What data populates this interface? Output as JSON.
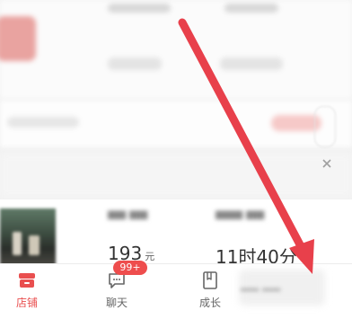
{
  "stats": {
    "value_1": "193",
    "unit_1": "元",
    "value_2": "11时40分"
  },
  "tabbar": {
    "tabs": [
      {
        "label": "店铺",
        "icon": "store-icon",
        "active": true
      },
      {
        "label": "聊天",
        "icon": "chat-icon",
        "active": false,
        "badge": "99+"
      },
      {
        "label": "成长",
        "icon": "growth-icon",
        "active": false
      }
    ]
  },
  "colors": {
    "accent": "#e94f4f",
    "badge": "#ee4d4d",
    "arrow": "#e8404b",
    "tab_inactive": "#666666"
  },
  "banner": {
    "close_icon": "close-icon"
  }
}
